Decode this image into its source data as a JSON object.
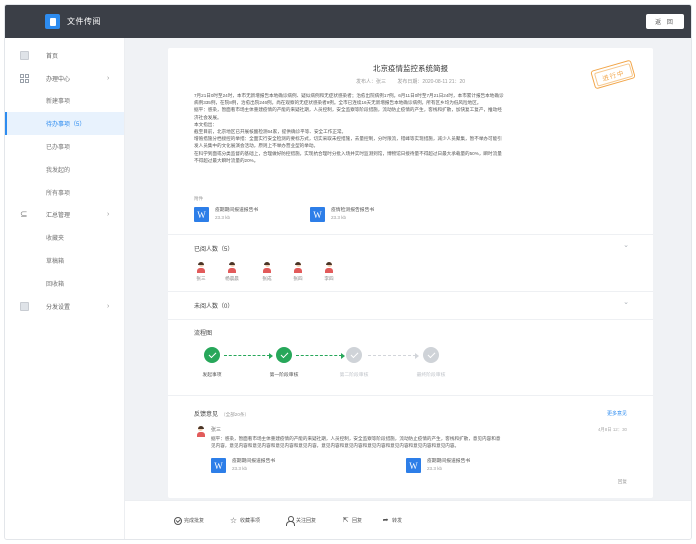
{
  "app": {
    "title": "文件传阅",
    "back_label": "返 回",
    "accent": "#2d8cf0"
  },
  "sidebar": {
    "items": [
      {
        "label": "首页",
        "icon": "home-icon"
      },
      {
        "label": "办理中心",
        "icon": "grid-icon"
      },
      {
        "label": "新建事项"
      },
      {
        "label": "待办事项（5）"
      },
      {
        "label": "已办事项"
      },
      {
        "label": "我发起的"
      },
      {
        "label": "所有事项"
      },
      {
        "label": "汇总管理",
        "icon": "summary-icon"
      },
      {
        "label": "收藏夹"
      },
      {
        "label": "草稿箱"
      },
      {
        "label": "回收箱"
      },
      {
        "label": "分发设置",
        "icon": "settings-icon"
      }
    ]
  },
  "document": {
    "title": "北京疫情监控系统简报",
    "publisher": "发布人：张三",
    "published_at": "发布日期：2020-08-11 21：20",
    "stamp": "进行中",
    "body": [
      "7月21日0时至24时，本市无新增报告本地确诊病例、疑似病例和无症状感染者；治愈出院病例17例。6月11日0时至7月21日24时，本市累计报告本地确诊",
      "病例335例，在院8例，治愈出院246例。尚在观察的无症状感染者9例。全市已连续16天无新增报告本地确诊病例，所有区乡均为低风险地区。",
      "据平：感染，暂面看市场主体重建疫情的产能的来疑社期，人员控制，安全监察等阶段措施，流动防止疫情的产生，客栈和扩散，加快复工复产，推动经",
      "济社会发展。",
      "本文指出：",
      "截至目前，北京地区已开展核酸检测64家，提供确诊平等、安全工作正常。",
      "增殖措施分档接控的举措：全面实行安全检测的要标方式，切实采取未控措施，去量控制，分时限流，错峰等实现措施，减少人员聚集，暂不举办可能引",
      "发人员集中的文化展演会活动，原则上不举办营业型的举动。",
      "在科学到面或分类监督的基础上，合理做好防控措施，实现抗合理时分批入场并实时监测到馆，博物馆日接待量不得超过日最大承载量的50%，瞬时流量",
      "不得超过最大瞬时流量的20%。"
    ],
    "attachments_label": "附件",
    "attachments": [
      {
        "name": "疫期期间报道报告书",
        "size": "23.3 kb"
      },
      {
        "name": "疫情检测报告报告书",
        "size": "23.3 kb"
      }
    ]
  },
  "read": {
    "title": "已阅人数（5）",
    "readers": [
      "张三",
      "杨晨晨",
      "张成",
      "张四",
      "李四"
    ]
  },
  "unread": {
    "title": "未阅人数（0）"
  },
  "flow": {
    "title": "流程图",
    "steps": [
      {
        "label": "发起事项",
        "done": true
      },
      {
        "label": "第一阶段审核",
        "done": true
      },
      {
        "label": "第二阶段审核",
        "done": false
      },
      {
        "label": "最终阶段审核",
        "done": false
      }
    ]
  },
  "feedback": {
    "title": "反馈意见",
    "count": "（全部20条）",
    "more": "更多意见",
    "name": "张三",
    "time": "4月8日 12：30",
    "text": [
      "据平：感染，暂面看市场主体重建疫情的产能的来疑社期，人员控制，安全监察等阶段措施，流动防止疫情的产生，客栈和扩散，意见内容和意",
      "见内容，意见内容和意见内容和意见内容和意见内容，意见内容和意见内容和意见内容和意见内容和意见内容和意见内容。"
    ],
    "attachments": [
      {
        "name": "疫期期间报道报告书",
        "size": "23.3 kb"
      },
      {
        "name": "疫期期间报道报告书",
        "size": "23.3 kb"
      }
    ],
    "reply": "回复"
  },
  "toolbar": {
    "items": [
      {
        "label": "完成批复",
        "icon": "circle-check-icon"
      },
      {
        "label": "收藏事项",
        "icon": "star-icon"
      },
      {
        "label": "关注回复",
        "icon": "person-icon"
      },
      {
        "label": "回复",
        "icon": "reply-icon"
      },
      {
        "label": "转发",
        "icon": "forward-icon"
      }
    ]
  }
}
